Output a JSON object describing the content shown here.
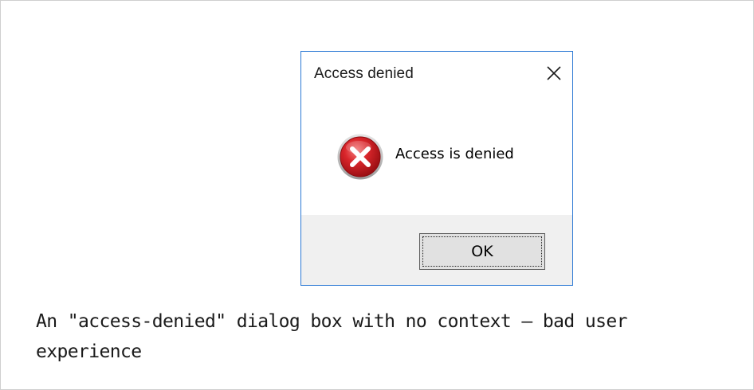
{
  "dialog": {
    "title": "Access denied",
    "message": "Access is denied",
    "ok_label": "OK",
    "icon": "error-icon"
  },
  "caption": "An \"access-denied\" dialog box with no context — bad user experience",
  "colors": {
    "dialog_border": "#2b78d4",
    "button_bar": "#f0f0f0",
    "error_red": "#c8181d"
  }
}
